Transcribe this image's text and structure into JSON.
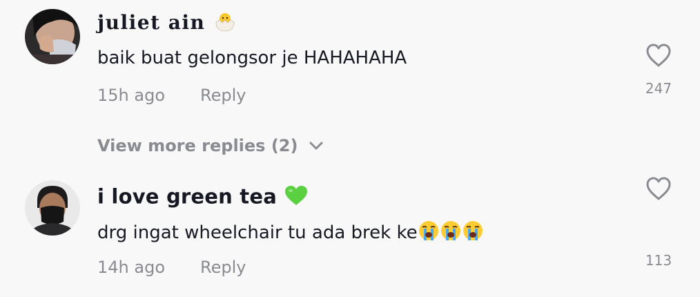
{
  "comments": [
    {
      "username": "juliet ain",
      "text": "baik buat gelongsor je HAHAHAHA",
      "time": "15h ago",
      "reply_label": "Reply",
      "likes": "247",
      "username_emoji": "hatching-chick-icon"
    },
    {
      "username": "i love green tea",
      "text": "drg ingat wheelchair tu ada brek ke",
      "time": "14h ago",
      "reply_label": "Reply",
      "likes": "113",
      "username_emoji": "green-heart-icon",
      "text_emoji": [
        "crying-face-icon",
        "crying-face-icon",
        "crying-face-icon"
      ]
    }
  ],
  "more_replies": {
    "label": "View more replies (2)"
  },
  "colors": {
    "background": "#f8f8f8",
    "text": "#161823",
    "muted": "#8a8b91",
    "green_heart": "#5bd041"
  }
}
